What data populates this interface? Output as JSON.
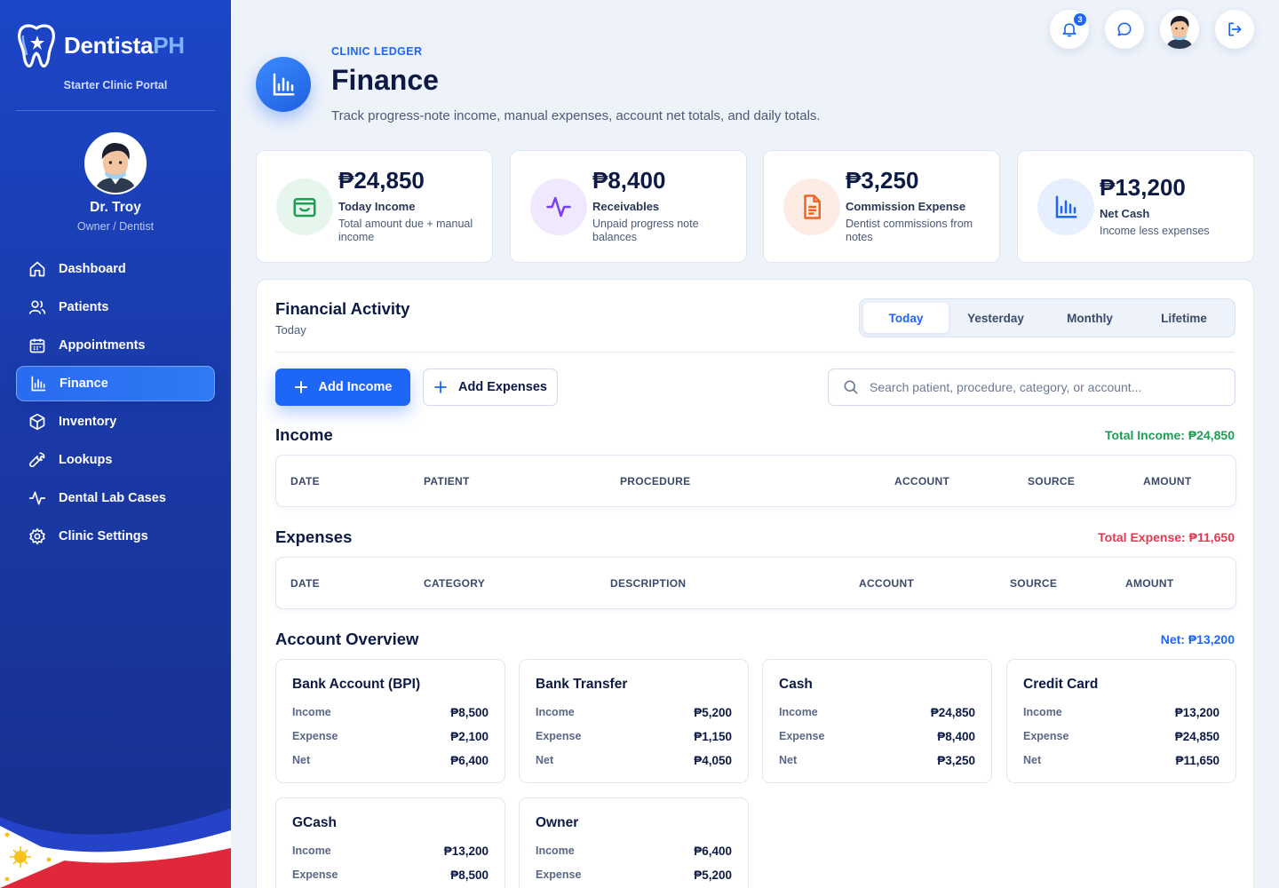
{
  "sidebar": {
    "brand_main": "Dentista",
    "brand_accent": "PH",
    "portal": "Starter Clinic Portal",
    "user_name": "Dr. Troy",
    "user_role": "Owner / Dentist",
    "nav": [
      {
        "label": "Dashboard",
        "icon": "home-icon"
      },
      {
        "label": "Patients",
        "icon": "users-icon"
      },
      {
        "label": "Appointments",
        "icon": "calendar-icon"
      },
      {
        "label": "Finance",
        "icon": "bar-chart-icon",
        "active": true
      },
      {
        "label": "Inventory",
        "icon": "box-icon"
      },
      {
        "label": "Lookups",
        "icon": "wrench-icon"
      },
      {
        "label": "Dental Lab Cases",
        "icon": "activity-icon"
      },
      {
        "label": "Clinic Settings",
        "icon": "gear-icon"
      }
    ]
  },
  "topbar": {
    "notification_count": "3",
    "icons": [
      "bell-icon",
      "message-icon",
      "avatar",
      "logout-icon"
    ]
  },
  "header": {
    "eyebrow": "CLINIC LEDGER",
    "title": "Finance",
    "subtitle": "Track progress-note income, manual expenses, account net totals, and daily totals."
  },
  "stats": [
    {
      "value": "₱24,850",
      "label": "Today Income",
      "desc": "Total amount due + manual income",
      "icon": "wallet-icon",
      "color": "#1e9d55",
      "bg": "#e6f6ec"
    },
    {
      "value": "₱8,400",
      "label": "Receivables",
      "desc": "Unpaid progress note balances",
      "icon": "pulse-icon",
      "color": "#7a3ff0",
      "bg": "#f0e8fd"
    },
    {
      "value": "₱3,250",
      "label": "Commission Expense",
      "desc": "Dentist commissions from notes",
      "icon": "document-icon",
      "color": "#f0642a",
      "bg": "#fdece4"
    },
    {
      "value": "₱13,200",
      "label": "Net Cash",
      "desc": "Income less expenses",
      "icon": "bar-chart-icon",
      "color": "#1e66f5",
      "bg": "#e6effd"
    }
  ],
  "activity": {
    "title": "Financial Activity",
    "period": "Today",
    "tabs": [
      "Today",
      "Yesterday",
      "Monthly",
      "Lifetime"
    ],
    "active_tab": "Today",
    "add_income": "Add Income",
    "add_expenses": "Add Expenses",
    "search_placeholder": "Search patient, procedure, category, or account..."
  },
  "income": {
    "title": "Income",
    "total": "Total Income: ₱24,850",
    "total_color": "#1e9d55",
    "columns": [
      "DATE",
      "PATIENT",
      "PROCEDURE",
      "ACCOUNT",
      "SOURCE",
      "AMOUNT"
    ]
  },
  "expenses": {
    "title": "Expenses",
    "total": "Total Expense: ₱11,650",
    "total_color": "#e03a4f",
    "columns": [
      "DATE",
      "CATEGORY",
      "DESCRIPTION",
      "ACCOUNT",
      "SOURCE",
      "AMOUNT"
    ]
  },
  "overview": {
    "title": "Account Overview",
    "net": "Net: ₱13,200",
    "net_color": "#1e66f5",
    "row_labels": [
      "Income",
      "Expense",
      "Net"
    ],
    "accounts": [
      {
        "name": "Bank Account (BPI)",
        "income": "₱8,500",
        "expense": "₱2,100",
        "net": "₱6,400"
      },
      {
        "name": "Bank Transfer",
        "income": "₱5,200",
        "expense": "₱1,150",
        "net": "₱4,050"
      },
      {
        "name": "Cash",
        "income": "₱24,850",
        "expense": "₱8,400",
        "net": "₱3,250"
      },
      {
        "name": "Credit Card",
        "income": "₱13,200",
        "expense": "₱24,850",
        "net": "₱11,650"
      },
      {
        "name": "GCash",
        "income": "₱13,200",
        "expense": "₱8,500",
        "net": ""
      },
      {
        "name": "Owner",
        "income": "₱6,400",
        "expense": "₱5,200",
        "net": ""
      }
    ]
  }
}
